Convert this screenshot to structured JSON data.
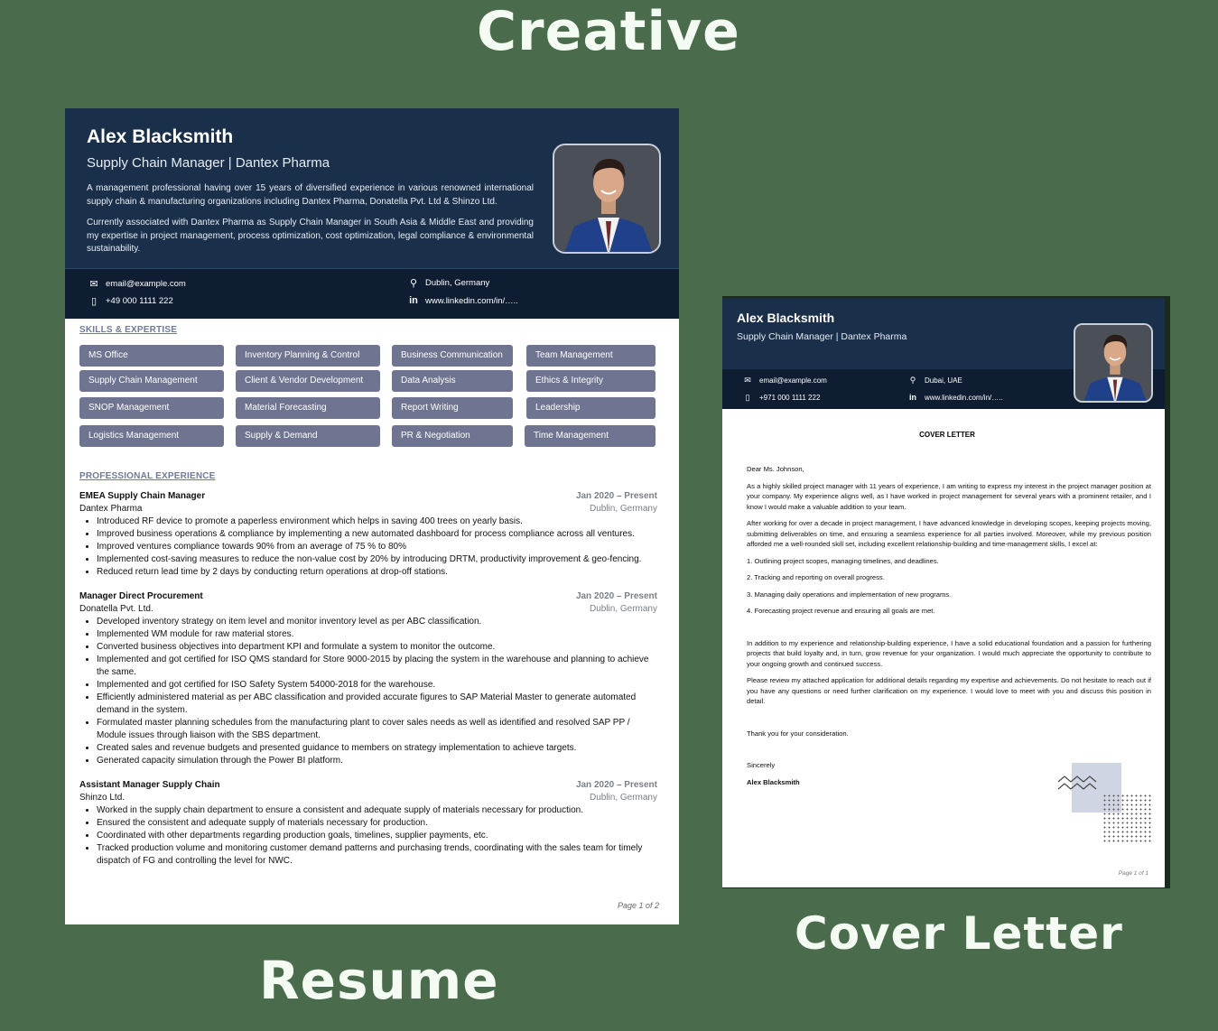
{
  "labels": {
    "creative": "Creative",
    "resume": "Resume",
    "cover_letter": "Cover Letter"
  },
  "resume": {
    "name": "Alex Blacksmith",
    "role": "Supply Chain Manager | Dantex Pharma",
    "summary": [
      "A management professional having over 15 years of diversified experience in various renowned international supply chain & manufacturing organizations including Dantex Pharma, Donatella Pvt. Ltd & Shinzo Ltd.",
      "Currently associated with Dantex Pharma as Supply Chain Manager in South Asia & Middle East and providing my expertise in project management, process optimization, cost optimization, legal compliance & environmental sustainability."
    ],
    "contact": {
      "email": "email@example.com",
      "phone": "+49 000 1111 222",
      "location": "Dublin, Germany",
      "linkedin": "www.linkedin.com/in/….."
    },
    "skills_title": "SKILLS & EXPERTISE",
    "skills": [
      "MS Office",
      "Inventory Planning & Control",
      "Business Communication",
      "Team Management",
      "Supply Chain Management",
      "Client & Vendor Development",
      "Data Analysis",
      "Ethics & Integrity",
      "SNOP Management",
      "Material Forecasting",
      "Report Writing",
      "Leadership",
      "Logistics Management",
      "Supply & Demand",
      "PR & Negotiation",
      "Time Management"
    ],
    "experience_title": "PROFESSIONAL EXPERIENCE",
    "jobs": [
      {
        "title": "EMEA Supply Chain Manager",
        "dates": "Jan 2020 – Present",
        "company": "Dantex Pharma",
        "location": "Dublin, Germany",
        "bullets": [
          "Introduced RF device to promote a paperless environment which helps in saving 400 trees on yearly basis.",
          "Improved business operations & compliance by implementing a new automated dashboard for process compliance across all ventures.",
          "Improved ventures compliance towards 90% from an average of 75 % to 80%",
          "Implemented cost-saving measures to reduce the non-value cost by 20% by introducing DRTM, productivity improvement & geo-fencing.",
          "Reduced return lead time by 2 days by conducting return operations at drop-off stations."
        ]
      },
      {
        "title": "Manager Direct Procurement",
        "dates": "Jan 2020 – Present",
        "company": "Donatella Pvt. Ltd.",
        "location": "Dublin, Germany",
        "bullets": [
          "Developed inventory strategy on item level and monitor inventory level as per ABC classification.",
          "Implemented WM module for raw material stores.",
          "Converted business objectives into department KPI and formulate a system to monitor the outcome.",
          "Implemented and got certified for ISO QMS standard for Store 9000-2015 by placing the system in the warehouse and planning to achieve the same.",
          "Implemented and got certified for ISO Safety System 54000-2018 for the warehouse.",
          "Efficiently administered material as per ABC classification and provided accurate figures to SAP Material Master to generate automated demand in the system.",
          "Formulated master planning schedules from the manufacturing plant to cover sales needs as well as identified and resolved SAP PP / Module issues through liaison with the SBS department.",
          "Created sales and revenue budgets and presented guidance to members on strategy implementation to achieve targets.",
          "Generated capacity simulation through the Power BI platform."
        ]
      },
      {
        "title": "Assistant Manager Supply Chain",
        "dates": "Jan 2020 – Present",
        "company": "Shinzo Ltd.",
        "location": "Dublin, Germany",
        "bullets": [
          "Worked in the supply chain department to ensure a consistent and adequate supply of materials necessary for production.",
          "Ensured the consistent and adequate supply of materials necessary for production.",
          "Coordinated with other departments regarding production goals, timelines, supplier payments, etc.",
          "Tracked production volume and monitoring customer demand patterns and purchasing trends, coordinating with the sales team for timely dispatch of FG and controlling the level for NWC."
        ]
      }
    ],
    "page_label": "Page 1 of 2"
  },
  "cover": {
    "name": "Alex Blacksmith",
    "role": "Supply Chain Manager | Dantex Pharma",
    "contact": {
      "email": "email@example.com",
      "phone": "+971 000 1111 222",
      "location": "Dubai, UAE",
      "linkedin": "www.linkedin.com/in/….."
    },
    "title": "COVER LETTER",
    "salutation": "Dear Ms. Johnson,",
    "paragraphs": [
      "As a highly skilled project manager with 11 years of experience, I am writing to express my interest in the project manager position at your company. My experience aligns well, as I have worked in project management for several years with a prominent retailer, and I know I would make a valuable addition to your team.",
      "After working for over a decade in project management, I have advanced knowledge in developing scopes, keeping projects moving, submitting deliverables on time, and ensuring a seamless experience for all parties involved. Moreover, while my previous position afforded me a well-rounded skill set, including excellent relationship-building and time-management skills, I excel at:"
    ],
    "list": [
      "1. Outlining project scopes, managing timelines, and deadlines.",
      "2. Tracking and reporting on overall progress.",
      "3. Managing daily operations and implementation of new programs.",
      "4. Forecasting project revenue and ensuring all goals are met."
    ],
    "paragraphs_after": [
      "In addition to my experience and relationship-building experience, I have a solid educational foundation and a passion for furthering projects that build loyalty and, in turn, grow revenue for your organization. I would much appreciate the opportunity to contribute to your ongoing growth and continued success.",
      "Please review my attached application for additional details regarding my expertise and achievements. Do not hesitate to reach out if you have any questions or need further clarification on my experience. I would love to meet with you and discuss this position in detail."
    ],
    "thanks": "Thank you for your consideration.",
    "closing": "Sincerely",
    "signature": "Alex Blacksmith",
    "page_label": "Page 1 of 1"
  }
}
